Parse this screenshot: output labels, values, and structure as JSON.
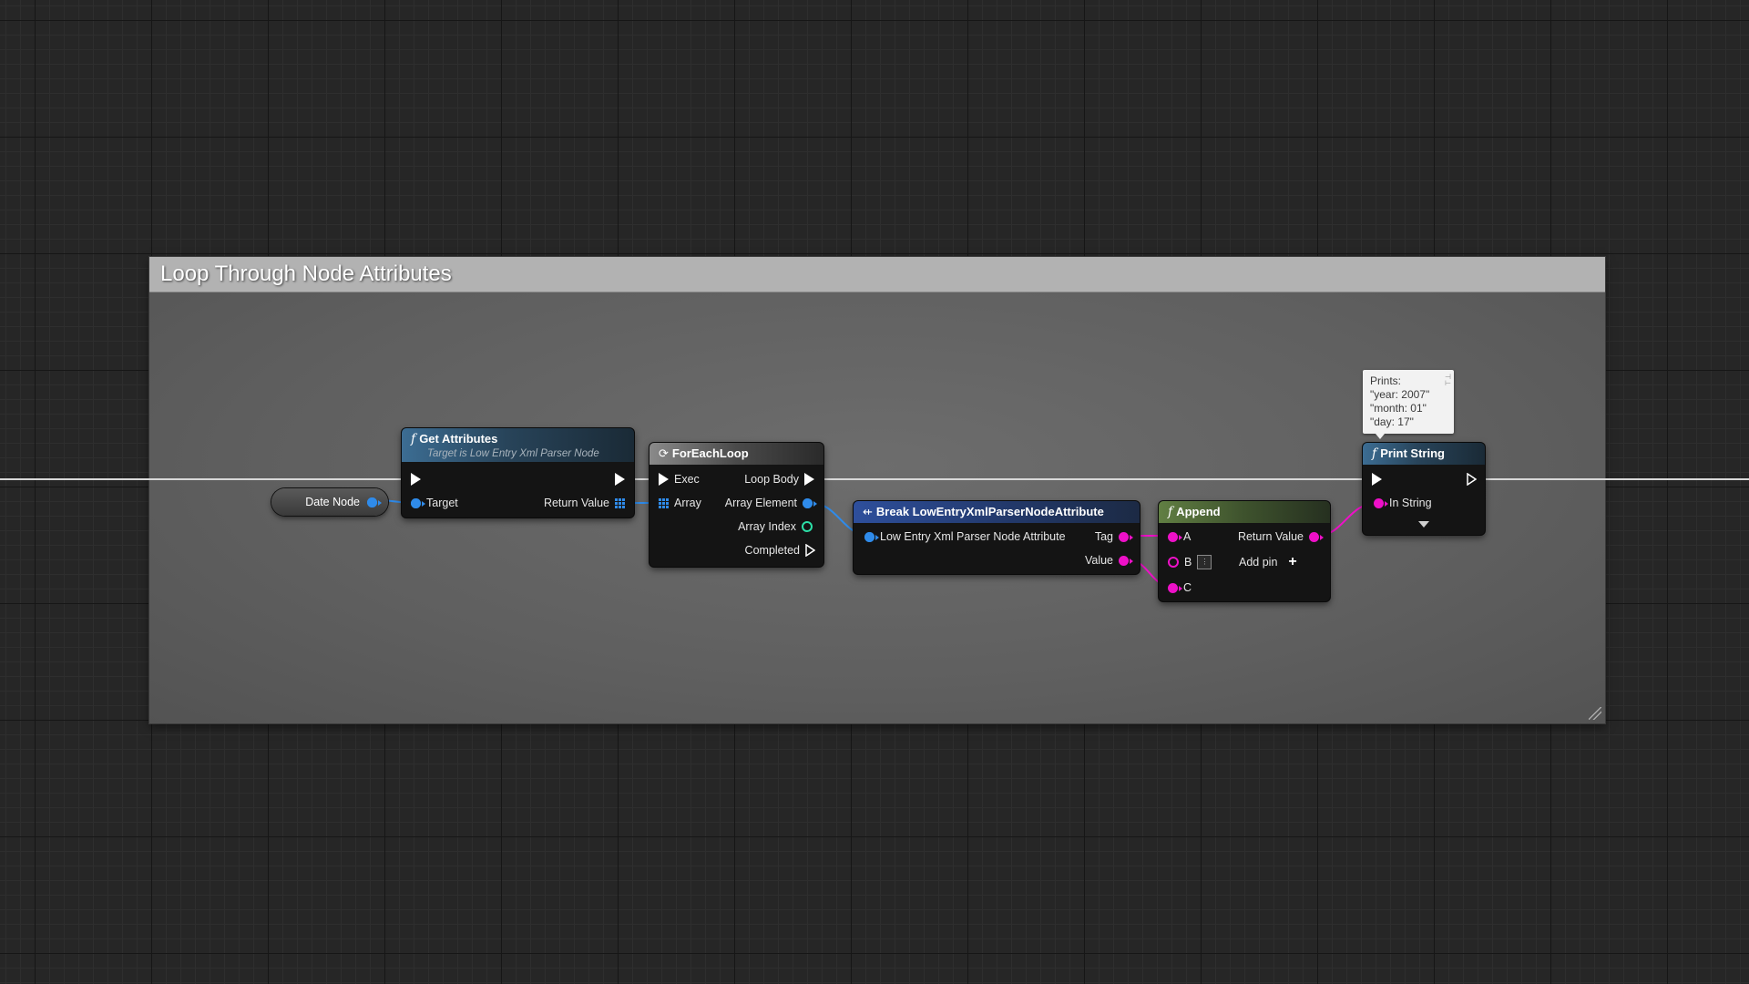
{
  "comment": {
    "title": "Loop Through Node Attributes"
  },
  "variable_node": {
    "label": "Date Node"
  },
  "get_attributes": {
    "title": "Get Attributes",
    "subtitle": "Target is Low Entry Xml Parser Node",
    "pins": {
      "target": "Target",
      "return_value": "Return Value"
    }
  },
  "for_each_loop": {
    "title": "ForEachLoop",
    "pins": {
      "exec": "Exec",
      "array": "Array",
      "loop_body": "Loop Body",
      "array_element": "Array Element",
      "array_index": "Array Index",
      "completed": "Completed"
    }
  },
  "break_node": {
    "title": "Break LowEntryXmlParserNodeAttribute",
    "pins": {
      "input": "Low Entry Xml Parser Node Attribute",
      "tag": "Tag",
      "value": "Value"
    }
  },
  "append": {
    "title": "Append",
    "pins": {
      "a": "A",
      "b": "B",
      "c": "C",
      "return_value": "Return Value",
      "add_pin": "Add pin"
    }
  },
  "print_string": {
    "title": "Print String",
    "pins": {
      "in_string": "In String"
    }
  },
  "tooltip": {
    "lines": [
      "Prints:",
      "\"year: 2007\"",
      "\"month: 01\"",
      "\"day: 17\""
    ]
  },
  "colors": {
    "object_pin": "#2f8bea",
    "string_pin": "#ee10c8",
    "int_pin": "#2ce0a8",
    "exec_pin": "#ffffff"
  }
}
